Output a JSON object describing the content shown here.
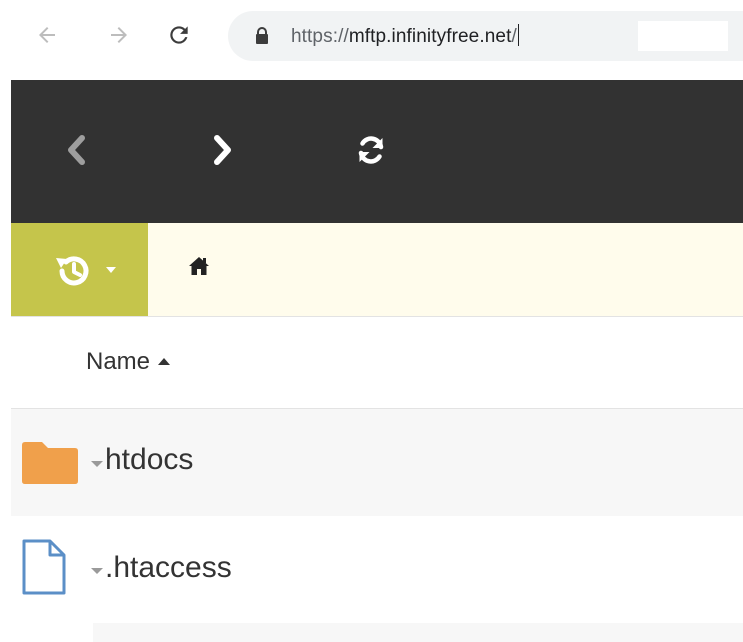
{
  "browser": {
    "url_scheme": "https://",
    "url_host": "mftp.infinityfree.net",
    "url_path": "/",
    "icons": {
      "back": "arrow-left-icon",
      "forward": "arrow-right-icon",
      "reload": "reload-icon",
      "lock": "lock-icon"
    }
  },
  "toolbar": {
    "icons": {
      "back": "chevron-left-icon",
      "forward": "chevron-right-icon",
      "refresh": "refresh-icon"
    }
  },
  "path_bar": {
    "icons": {
      "history": "history-icon",
      "home": "home-icon"
    }
  },
  "file_list": {
    "columns": [
      {
        "label": "Name",
        "sort": "ascending"
      }
    ],
    "items": [
      {
        "name": "htdocs",
        "type": "folder",
        "icon": "folder-icon"
      },
      {
        "name": ".htaccess",
        "type": "file",
        "icon": "file-icon"
      }
    ]
  },
  "colors": {
    "toolbar_bg": "#323232",
    "history_button_bg": "#c5c54b",
    "path_bar_bg": "#fffcec",
    "folder": "#f0a04b",
    "file_outline": "#5b8fc7"
  }
}
